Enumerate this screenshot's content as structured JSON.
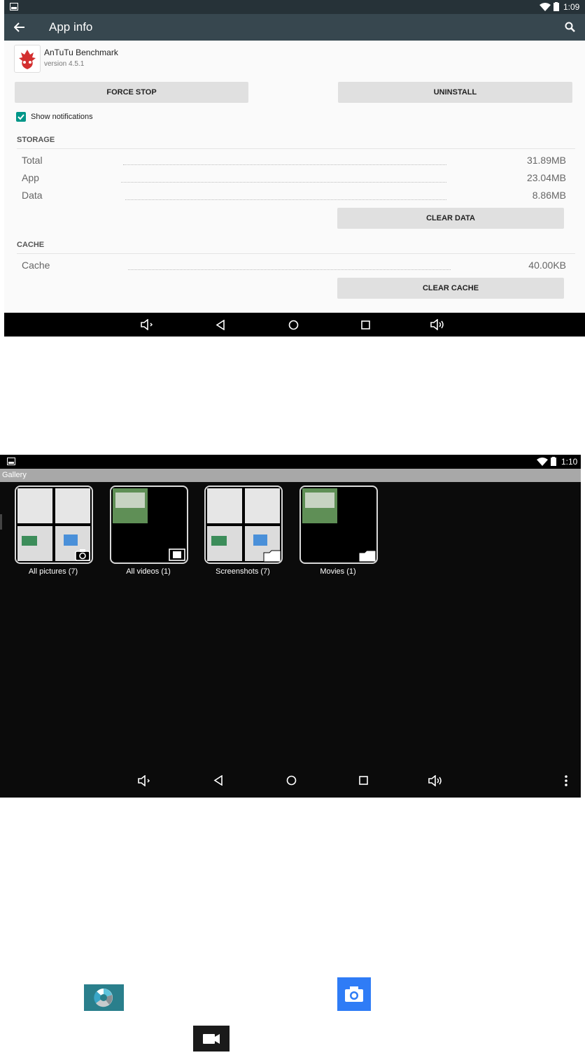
{
  "app_info": {
    "status": {
      "time": "1:09"
    },
    "appbar": {
      "title": "App info"
    },
    "app": {
      "name": "AnTuTu Benchmark",
      "version": "version 4.5.1"
    },
    "buttons": {
      "force_stop": "FORCE STOP",
      "uninstall": "UNINSTALL",
      "clear_data": "CLEAR DATA",
      "clear_cache": "CLEAR CACHE"
    },
    "notifications": {
      "label": "Show notifications",
      "checked": true
    },
    "storage": {
      "header": "STORAGE",
      "rows": [
        {
          "label": "Total",
          "value": "31.89MB"
        },
        {
          "label": "App",
          "value": "23.04MB"
        },
        {
          "label": "Data",
          "value": "8.86MB"
        }
      ]
    },
    "cache": {
      "header": "CACHE",
      "rows": [
        {
          "label": "Cache",
          "value": "40.00KB"
        }
      ]
    }
  },
  "gallery": {
    "status": {
      "time": "1:10"
    },
    "title": "Gallery",
    "albums": [
      {
        "label": "All pictures (7)",
        "badge": "camera-icon"
      },
      {
        "label": "All videos (1)",
        "badge": "film-icon"
      },
      {
        "label": "Screenshots (7)",
        "badge": "folder-icon"
      },
      {
        "label": "Movies (1)",
        "badge": "folder-icon"
      }
    ]
  },
  "icons": [
    "gallery-app-icon",
    "camera-app-icon",
    "video-camera-app-icon"
  ],
  "colors": {
    "accent": "#009688",
    "appbar": "#37474f",
    "camera_blue": "#2f7cf6",
    "gallery_teal": "#2a7f8c"
  }
}
